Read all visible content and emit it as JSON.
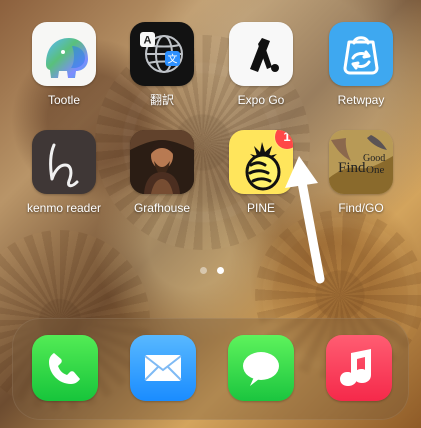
{
  "home_screen": {
    "apps": [
      {
        "label": "Tootle",
        "icon": "elephant-icon"
      },
      {
        "label": "翻訳",
        "icon": "translate-globe-icon"
      },
      {
        "label": "Expo Go",
        "icon": "expo-go-icon"
      },
      {
        "label": "Retwpay",
        "icon": "shopping-bag-icon"
      },
      {
        "label": "kenmo reader",
        "icon": "handwriting-h-icon"
      },
      {
        "label": "Grafhouse",
        "icon": "portrait-icon"
      },
      {
        "label": "PINE",
        "icon": "pineapple-icon",
        "badge": "1"
      },
      {
        "label": "Find/GO",
        "icon": "find-good-one-icon"
      }
    ],
    "page_indicator": {
      "pages": 2,
      "active_index": 1
    },
    "dock": [
      {
        "label": "Phone",
        "icon": "phone-icon"
      },
      {
        "label": "Mail",
        "icon": "mail-icon"
      },
      {
        "label": "Messages",
        "icon": "messages-icon"
      },
      {
        "label": "Music",
        "icon": "music-note-icon"
      }
    ],
    "annotation": {
      "arrow_color": "#ffffff",
      "target": "PINE badge"
    },
    "colors": {
      "badge": "#ff4747",
      "dock_background": "rgba(120,92,60,0.38)"
    }
  }
}
